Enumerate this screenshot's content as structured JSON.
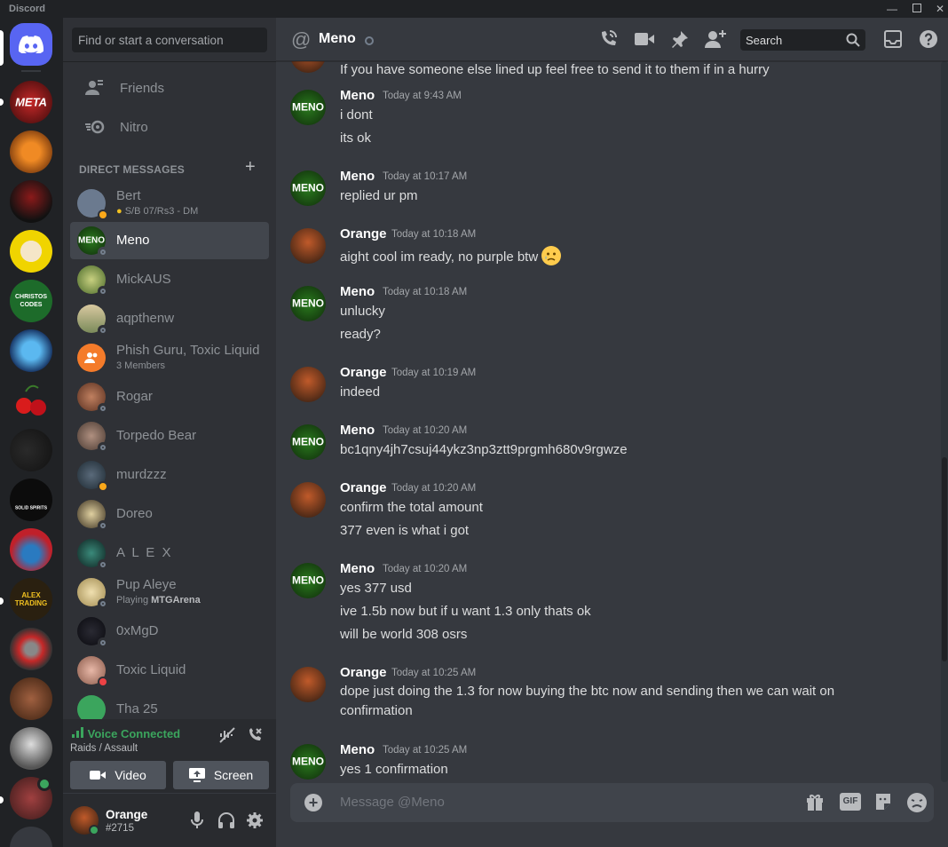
{
  "window": {
    "title": "Discord"
  },
  "rail": {
    "servers": [
      {
        "name": "Discord Home"
      },
      {
        "name": "META",
        "text": "META"
      },
      {
        "name": "pumpkin"
      },
      {
        "name": "dark-figure"
      },
      {
        "name": "chef-dog"
      },
      {
        "name": "CHRISTOS CODES",
        "text": "CHRISTOS CODES"
      },
      {
        "name": "blue-drop"
      },
      {
        "name": "cherries"
      },
      {
        "name": "panther"
      },
      {
        "name": "SOLID SPIRITS",
        "text": "SOLID SPIRITS"
      },
      {
        "name": "santa-hat"
      },
      {
        "name": "ALEX TRADING",
        "text": "ALEX TRADING"
      },
      {
        "name": "spartan"
      },
      {
        "name": "beast"
      },
      {
        "name": "portrait"
      },
      {
        "name": "warrior"
      }
    ]
  },
  "sidebar": {
    "search_placeholder": "Find or start a conversation",
    "friends": "Friends",
    "nitro": "Nitro",
    "dm_header": "DIRECT MESSAGES",
    "dms": [
      {
        "name": "Bert",
        "sub": "S/B 07/Rs3 - DM",
        "status": "idle",
        "color": "#6b7a8f"
      },
      {
        "name": "Meno",
        "status": "offline",
        "color": "#1f5a16",
        "active": true
      },
      {
        "name": "MickAUS",
        "status": "offline",
        "color": "#8aa05a"
      },
      {
        "name": "aqpthenw",
        "status": "offline",
        "color": "#b8a888"
      },
      {
        "name": "Phish Guru, Toxic Liquid",
        "sub": "3 Members",
        "status": "group",
        "color": "#f47b2a"
      },
      {
        "name": "Rogar",
        "status": "offline",
        "color": "#a0704a"
      },
      {
        "name": "Torpedo Bear",
        "status": "offline",
        "color": "#8a7060"
      },
      {
        "name": "murdzzz",
        "status": "idle",
        "color": "#3e4a55"
      },
      {
        "name": "Doreo",
        "status": "offline",
        "color": "#c8b070"
      },
      {
        "name": "A L E X",
        "status": "offline",
        "color": "#2a4f4a"
      },
      {
        "name": "Pup Aleye",
        "sub_prefix": "Playing ",
        "sub_bold": "MTGArena",
        "status": "offline",
        "color": "#d9c89a"
      },
      {
        "name": "0xMgD",
        "status": "offline",
        "color": "#1b1b22"
      },
      {
        "name": "Toxic Liquid",
        "status": "dnd",
        "color": "#d9a090"
      },
      {
        "name": "Tha 25",
        "status": "offline",
        "color": "#3ba55d"
      }
    ],
    "voice": {
      "status": "Voice Connected",
      "channel": "Raids / Assault",
      "video_label": "Video",
      "screen_label": "Screen"
    },
    "user": {
      "name": "Orange",
      "tag": "#2715"
    }
  },
  "header": {
    "name": "Meno",
    "search_placeholder": "Search"
  },
  "messages": {
    "partial_top": "If you have someone else lined up feel free to send it to them if in a hurry",
    "groups": [
      {
        "author": "Meno",
        "time": "Today at 9:43 AM",
        "lines": [
          "i dont",
          "its ok"
        ]
      },
      {
        "author": "Meno",
        "time": "Today at 10:17 AM",
        "lines": [
          "replied ur pm"
        ]
      },
      {
        "author": "Orange",
        "time": "Today at 10:18 AM",
        "lines": [
          "aight cool im ready, no purple btw"
        ]
      },
      {
        "author": "Meno",
        "time": "Today at 10:18 AM",
        "lines": [
          "unlucky",
          "ready?"
        ]
      },
      {
        "author": "Orange",
        "time": "Today at 10:19 AM",
        "lines": [
          "indeed"
        ]
      },
      {
        "author": "Meno",
        "time": "Today at 10:20 AM",
        "lines": [
          "bc1qny4jh7csuj44ykz3np3ztt9prgmh680v9rgwze"
        ]
      },
      {
        "author": "Orange",
        "time": "Today at 10:20 AM",
        "lines": [
          "confirm the total amount",
          "377 even is what i got"
        ]
      },
      {
        "author": "Meno",
        "time": "Today at 10:20 AM",
        "lines": [
          "yes 377 usd",
          "ive 1.5b now but if u want 1.3 only thats ok",
          "will be world 308 osrs"
        ]
      },
      {
        "author": "Orange",
        "time": "Today at 10:25 AM",
        "lines": [
          "dope just doing the 1.3 for now buying the btc now and sending then we can wait on confirmation"
        ]
      },
      {
        "author": "Meno",
        "time": "Today at 10:25 AM",
        "lines": [
          "yes 1 confirmation"
        ]
      }
    ]
  },
  "composer": {
    "placeholder": "Message @Meno",
    "gif_label": "GIF"
  },
  "colors": {
    "blurple": "#5865f2",
    "green": "#3ba55d",
    "bg_main": "#36393f",
    "bg_sidebar": "#2f3136",
    "bg_rail": "#202225"
  }
}
